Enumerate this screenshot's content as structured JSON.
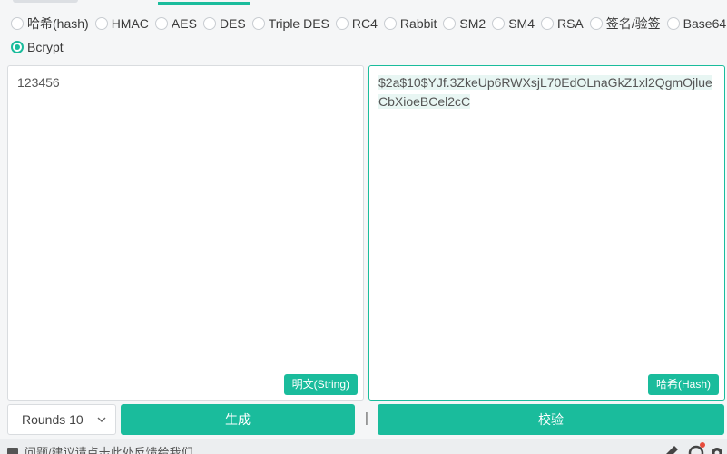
{
  "algorithms": [
    {
      "label": "哈希(hash)",
      "selected": false
    },
    {
      "label": "HMAC",
      "selected": false
    },
    {
      "label": "AES",
      "selected": false
    },
    {
      "label": "DES",
      "selected": false
    },
    {
      "label": "Triple DES",
      "selected": false
    },
    {
      "label": "RC4",
      "selected": false
    },
    {
      "label": "Rabbit",
      "selected": false
    },
    {
      "label": "SM2",
      "selected": false
    },
    {
      "label": "SM4",
      "selected": false
    },
    {
      "label": "RSA",
      "selected": false
    },
    {
      "label": "签名/验签",
      "selected": false
    },
    {
      "label": "Base64",
      "selected": false
    },
    {
      "label": "Bcrypt",
      "selected": true
    }
  ],
  "input": {
    "value": "123456",
    "tag": "明文(String)"
  },
  "output": {
    "value": "$2a$10$YJf.3ZkeUp6RWXsjL70EdOLnaGkZ1xl2QgmOjlueCbXioeBCel2cC",
    "tag": "哈希(Hash)"
  },
  "controls": {
    "rounds_selected": "Rounds 10",
    "generate_label": "生成",
    "separator": "|",
    "verify_label": "校验"
  },
  "footer": {
    "text": "问题/建议请点击此处反馈给我们"
  },
  "colors": {
    "accent": "#1abc9c"
  },
  "icons": {
    "footer": "feedback-icon",
    "toolbar": [
      "edit-icon",
      "history-icon",
      "settings-icon"
    ]
  }
}
